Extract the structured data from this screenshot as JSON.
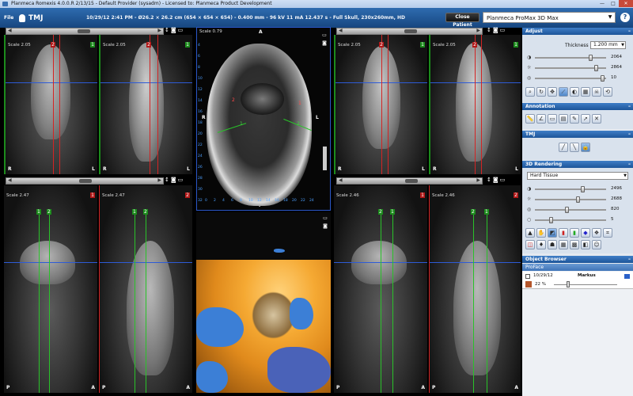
{
  "window": {
    "title": "Planmeca Romexis 4.0.0.R   2/13/15 - Default Provider (sysadm) - Licensed to: Planmeca Product Development",
    "controls": [
      "minimize",
      "maximize",
      "close"
    ]
  },
  "toolbar": {
    "file_label": "File",
    "module_label": "TMJ",
    "scan_info": "10/29/12 2:41 PM - Ø26.2 × 26.2 cm (654 × 654 × 654) - 0.400 mm - 96 kV 11 mA 12.437 s - Full Skull, 230x260mm, HD",
    "close_patient_label": "Close Patient",
    "device_value": "Planmeca ProMax 3D Max",
    "help_label": "?"
  },
  "views": {
    "top_left_a": {
      "scale": "Scale 2.05",
      "badges": [
        "2",
        "1"
      ],
      "corners": [
        "R",
        "L"
      ]
    },
    "top_left_b": {
      "scale": "Scale 2.05",
      "badges": [
        "2",
        "1"
      ],
      "corners": [
        "R",
        "L"
      ]
    },
    "axial": {
      "scale": "Scale 0.79",
      "top": "A",
      "left": "R",
      "right": "L",
      "bottom": "P",
      "ruler_left": [
        "4",
        "6",
        "8",
        "10",
        "12",
        "14",
        "16",
        "18",
        "20",
        "22",
        "24",
        "26",
        "28",
        "30",
        "32"
      ],
      "ruler_bottom": [
        "0",
        "2",
        "4",
        "6",
        "8",
        "10",
        "12",
        "14",
        "16",
        "18",
        "20",
        "22",
        "24"
      ],
      "markers_red": [
        "2",
        "1"
      ],
      "markers_green": [
        "1",
        "2"
      ]
    },
    "top_right_a": {
      "scale": "Scale 2.05",
      "badges": [
        "2",
        "1"
      ],
      "corners": [
        "R",
        "L"
      ]
    },
    "top_right_b": {
      "scale": "Scale 2.05",
      "badges": [
        "2",
        "1"
      ],
      "corners": [
        "R",
        "L"
      ]
    },
    "bottom_left_a": {
      "scale": "Scale 2.47",
      "badges": [
        "1"
      ],
      "corners": [
        "P",
        "A"
      ],
      "line_labels": [
        "1",
        "2"
      ]
    },
    "bottom_left_b": {
      "scale": "Scale 2.47",
      "badges": [
        "2"
      ],
      "corners": [
        "P",
        "A"
      ],
      "line_labels": [
        "1",
        "2"
      ]
    },
    "bottom_right_a": {
      "scale": "Scale 2.46",
      "badges": [
        "1"
      ],
      "corners": [
        "P",
        "A"
      ],
      "line_labels": [
        "2",
        "1"
      ]
    },
    "bottom_right_b": {
      "scale": "Scale 2.46",
      "badges": [
        "2"
      ],
      "corners": [
        "P",
        "A"
      ],
      "line_labels": [
        "2",
        "1"
      ]
    }
  },
  "panel": {
    "adjust": {
      "header": "Adjust",
      "thickness_label": "Thickness",
      "thickness_value": "1.200 mm",
      "sliders": [
        {
          "icon": "contrast-icon",
          "value": "2064",
          "level": 0.78
        },
        {
          "icon": "brightness-icon",
          "value": "2864",
          "level": 0.86
        },
        {
          "icon": "gamma-icon",
          "value": "10",
          "level": 0.95
        }
      ]
    },
    "annotation": {
      "header": "Annotation"
    },
    "tmj": {
      "header": "TMJ"
    },
    "rendering": {
      "header": "3D Rendering",
      "preset_value": "Hard Tissue",
      "sliders": [
        {
          "icon": "contrast-icon",
          "value": "2496",
          "level": 0.68
        },
        {
          "icon": "brightness-icon",
          "value": "2688",
          "level": 0.62
        },
        {
          "icon": "gamma-icon",
          "value": "820",
          "level": 0.45
        },
        {
          "icon": "opacity-icon",
          "value": "5",
          "level": 0.22
        }
      ]
    },
    "object_browser": {
      "header": "Object Browser",
      "profile_label": "ProFace",
      "item_date": "10/29/12",
      "item_name": "Markus",
      "item_percent": "22 %"
    }
  }
}
